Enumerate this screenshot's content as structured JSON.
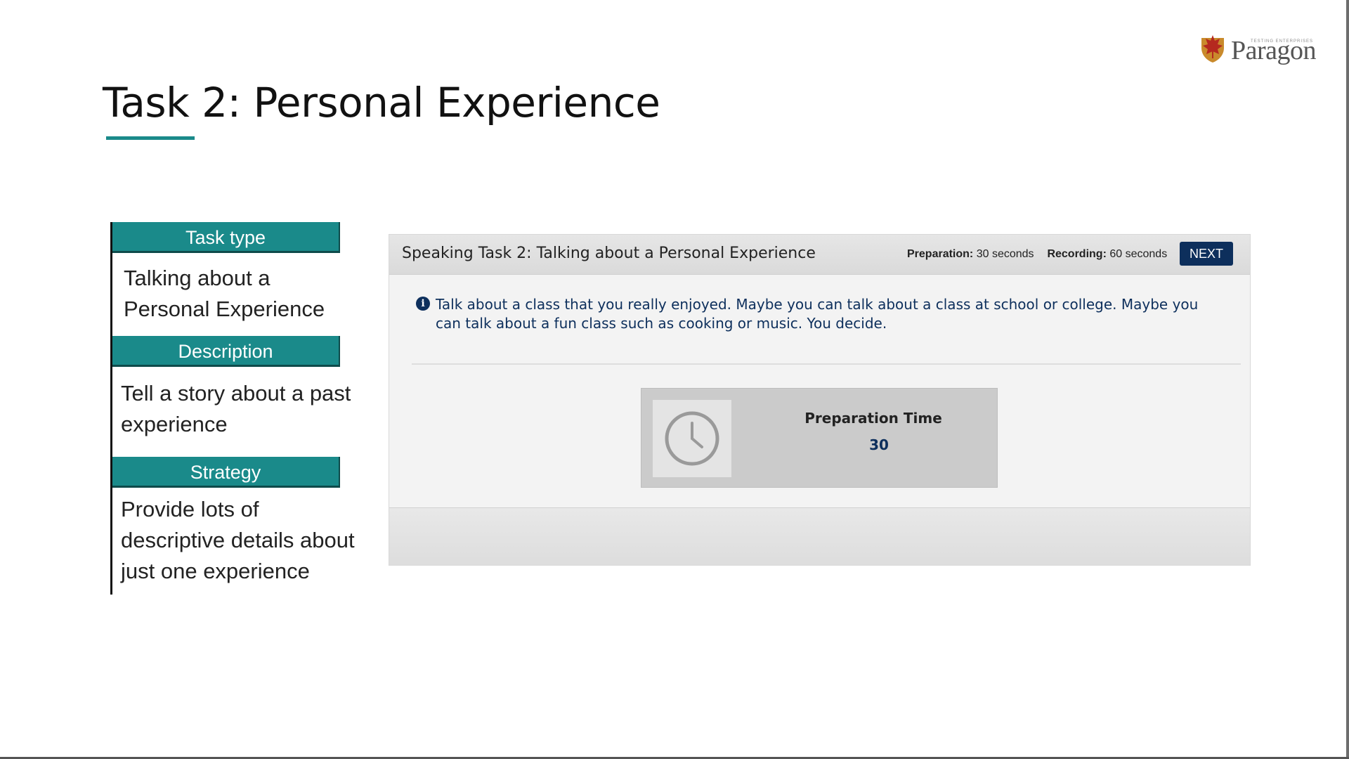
{
  "slide": {
    "title": "Task 2: Personal Experience",
    "accent_color": "#1a8a8a"
  },
  "logo": {
    "wordmark": "Paragon",
    "tagline": "TESTING ENTERPRISES",
    "icon": "maple-leaf-shield-icon"
  },
  "info": {
    "task_type_label": "Task type",
    "task_type_line1": "Talking about a",
    "task_type_line2": "Personal Experience",
    "description_label": "Description",
    "description_line1": "Tell a story about a past",
    "description_line2": "experience",
    "strategy_label": "Strategy",
    "strategy_line1": "Provide lots of",
    "strategy_line2": "descriptive details about",
    "strategy_line3": "just one experience"
  },
  "panel": {
    "title": "Speaking Task 2: Talking about a Personal Experience",
    "preparation_label": "Preparation:",
    "preparation_value": "30 seconds",
    "recording_label": "Recording:",
    "recording_value": "60 seconds",
    "next_label": "NEXT",
    "info_icon": "info-icon",
    "prompt": "Talk about a class that you really enjoyed. Maybe you can talk about a class at school or college. Maybe you can talk about a fun class such as cooking or music. You decide.",
    "prep_time_label": "Preparation Time",
    "prep_time_value": "30",
    "clock_icon": "clock-icon",
    "brand_color": "#0d2f5c"
  }
}
